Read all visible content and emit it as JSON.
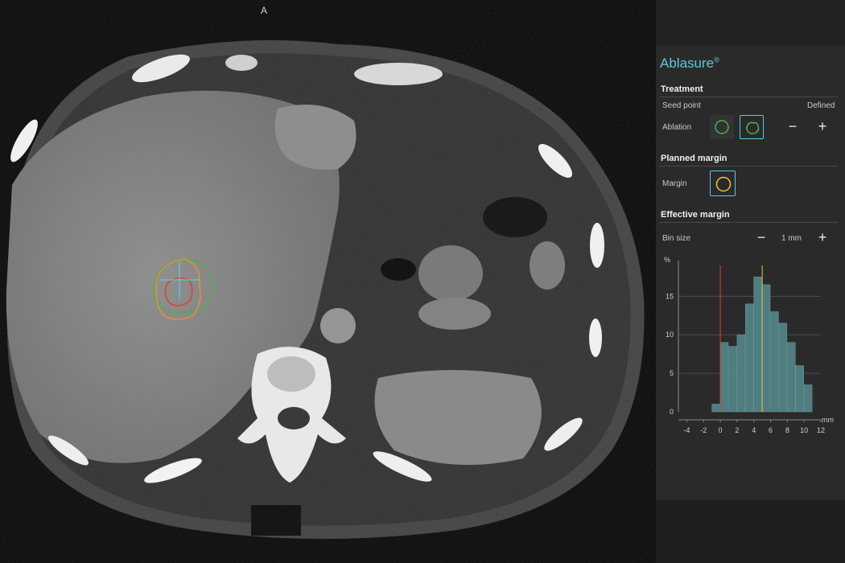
{
  "viewer": {
    "orientation_label": "A"
  },
  "panel": {
    "app_name": "Ablasure",
    "app_mark": "®",
    "treatment": {
      "title": "Treatment",
      "seed_label": "Seed point",
      "seed_value": "Defined",
      "ablation_label": "Ablation",
      "minus": "−",
      "plus": "+"
    },
    "planned_margin": {
      "title": "Planned margin",
      "margin_label": "Margin"
    },
    "effective_margin": {
      "title": "Effective margin",
      "bin_label": "Bin size",
      "bin_value": "1 mm",
      "minus": "−",
      "plus": "+"
    }
  },
  "colors": {
    "accent": "#5ec8dc",
    "green": "#4caf50",
    "orange": "#e0913a",
    "yellow": "#e8c23e",
    "red": "#d9442e",
    "bar": "#4f7d80"
  },
  "chart_data": {
    "type": "bar",
    "ylabel": "%",
    "xlabel": "mm",
    "x": [
      -1,
      0,
      1,
      2,
      3,
      4,
      5,
      6,
      7,
      8,
      9,
      10
    ],
    "values": [
      1,
      9,
      8.5,
      10,
      14,
      17.5,
      16.5,
      13,
      11.5,
      9,
      6,
      3.5
    ],
    "xticks": [
      -4,
      -2,
      0,
      2,
      4,
      6,
      8,
      10,
      12
    ],
    "yticks": [
      0,
      5,
      10,
      15
    ],
    "xlim": [
      -5,
      12
    ],
    "ylim": [
      0,
      19
    ],
    "vlines": [
      {
        "x": 0,
        "color": "#d9442e"
      },
      {
        "x": 5,
        "color": "#e8c23e"
      }
    ],
    "grid": true
  }
}
